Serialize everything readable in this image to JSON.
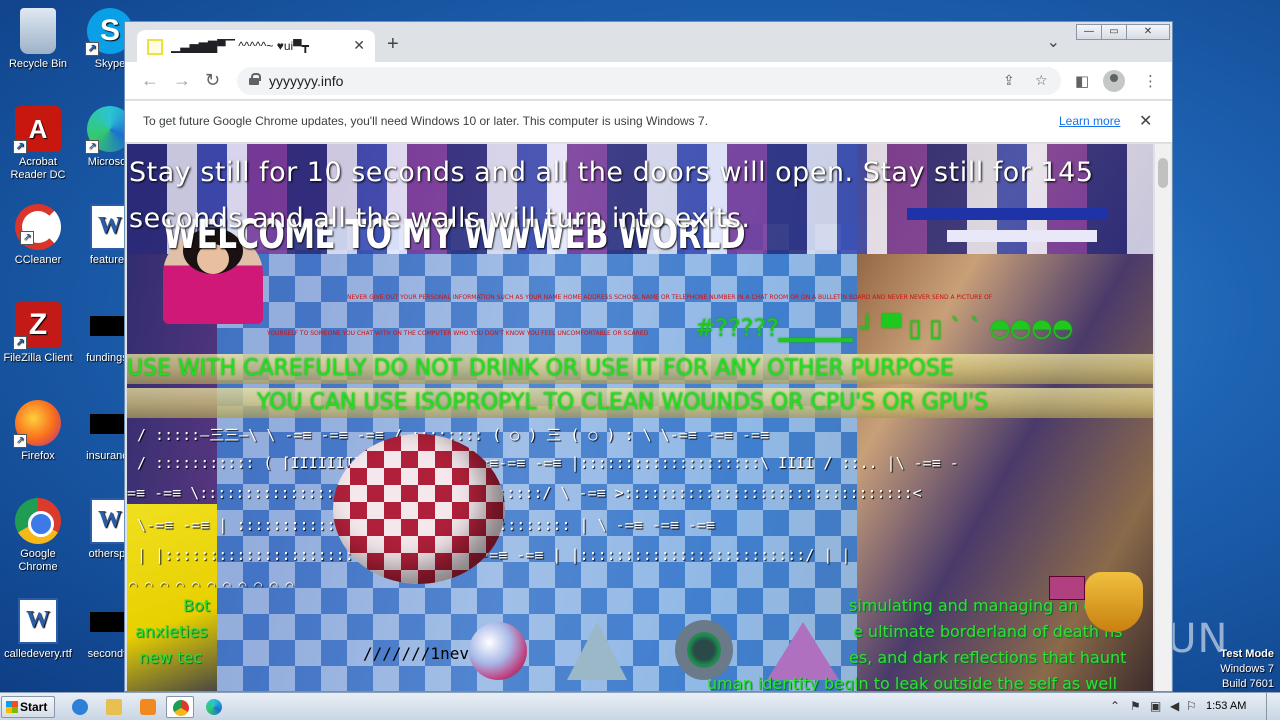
{
  "desktop": {
    "icons": [
      {
        "label": "Recycle Bin",
        "icon": "recycle-bin-icon"
      },
      {
        "label": "Skype",
        "icon": "skype-icon"
      },
      {
        "label": "Acrobat Reader DC",
        "icon": "acrobat-icon"
      },
      {
        "label": "Microsoft",
        "icon": "edge-icon"
      },
      {
        "label": "CCleaner",
        "icon": "ccleaner-icon"
      },
      {
        "label": "featured",
        "icon": "word-doc-icon"
      },
      {
        "label": "FileZilla Client",
        "icon": "filezilla-icon"
      },
      {
        "label": "fundingse",
        "icon": "blank-file-icon"
      },
      {
        "label": "Firefox",
        "icon": "firefox-icon"
      },
      {
        "label": "insurance",
        "icon": "blank-file-icon"
      },
      {
        "label": "Google Chrome",
        "icon": "chrome-icon"
      },
      {
        "label": "otherspo",
        "icon": "word-doc-icon"
      },
      {
        "label": "calledevery.rtf",
        "icon": "word-doc-icon"
      },
      {
        "label": "secondto",
        "icon": "blank-file-icon"
      }
    ],
    "watermark": "ANY RUN",
    "test_mode": {
      "line1": "Test Mode",
      "line2": "Windows 7",
      "line3": "Build 7601"
    }
  },
  "browser": {
    "tab_title": "▁▃▅▆▇▀▔ ^^^^^~ ♥ui▀┳",
    "tab_close": "✕",
    "new_tab": "+",
    "tab_search": "⌄",
    "window_controls": {
      "minimize": "—",
      "maximize": "▭",
      "close": "✕"
    },
    "nav": {
      "back": "←",
      "forward": "→",
      "reload": "↻"
    },
    "url": "yyyyyyy.info",
    "toolbar_icons": {
      "share": "⇪",
      "bookmark": "☆",
      "sidepanel": "◧",
      "menu": "⋮"
    },
    "infobar": {
      "message": "To get future Google Chrome updates, you'll need Windows 10 or later. This computer is using Windows 7.",
      "link": "Learn more",
      "close": "✕"
    }
  },
  "page": {
    "stay_text": "Stay still for 10 seconds and all the doors will open. Stay still for 145 seconds and all the walls will turn into exits.",
    "welcome": "WELCOME TO MY WWWEB WORLD",
    "red_line1": "NEVER GIVE OUT YOUR PERSONAL INFORMATION SUCH AS YOUR NAME HOME ADDRESS SCHOOL NAME OR TELEPHONE NUMBER IN A CHAT ROOM OR ON A BULLETIN BOARD AND NEVER NEVER SEND A PICTURE OF",
    "red_line2": "YOURSELF TO SOMEONE YOU CHAT WITH ON THE COMPUTER WHO YOU DON'T KNOW YOU FEEL UNCOMFORTABLE OR SCARED",
    "glyphs_row": "#?????▁▁▁▁  ┘  ▀  ▯ ▯  ˋ ˋ ◓◓◓◓",
    "warning1": "USE WITH CAREFULLY DO NOT DRINK OR USE IT FOR ANY OTHER PURPOSE",
    "warning2": "YOU CAN USE ISOPROPYL TO CLEAN WOUNDS OR CPU'S OR GPU'S",
    "ascii1": "/ :::::—三三—\\      \\    -=≡       -=≡      -=≡      / :::::::: ( ○ ) 三 ( ○ ) : \\  \\-=≡   -=≡       -=≡",
    "ascii2": "   / ::::::::::: ( ⌈IIIIIIII(::::\\ \\-=≡     -=≡-=≡   -=≡      |::::::::::::::::::::\\ IIII / ::..   |\\       -=≡        -",
    "ascii3": "=≡    -=≡   \\:::::::::::::::::::U::::::::::::::::::/ \\                          -=≡                 >::::::::::::::::::::::::::::::::<",
    "ascii4": "       \\-=≡      -=≡                       | ::::::::::::::::::::::::::::::::::::: | \\      -=≡          -=≡      -=≡",
    "ascii5": "              | |::::::::::::::::::::::::::/   | \\-=≡       -=≡        -=≡              | |:::::::::::::::::::::::::/ |  |",
    "bottom_left_text": "Bot",
    "bottom_anxieties": "anxieties",
    "bottom_newtec": "new tec",
    "bottom_slashes": "///////1nev",
    "bottom_right1": "simulating and managing an     e",
    "bottom_right2": "e ultimate borderland of death   ns",
    "bottom_right3": "es, and dark reflections that haunt",
    "bottom_right4": "uman identity begin to leak outside the self as well",
    "small_ascii": "⌒ ⌒ ⌒ ⌒ ⌒ ⌒ ⌒ ⌒ ⌒ ⌒ ⌒"
  },
  "taskbar": {
    "start_label": "Start",
    "clock": "1:53 AM",
    "tray": {
      "up": "⌃",
      "flag": "⚑",
      "net": "▣",
      "volume": "◀",
      "action": "⚐"
    }
  }
}
